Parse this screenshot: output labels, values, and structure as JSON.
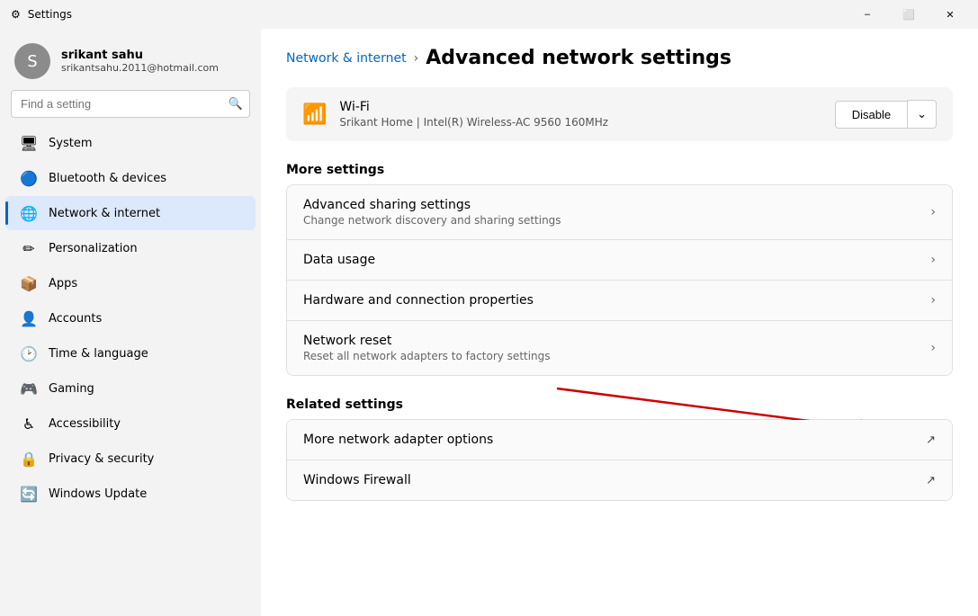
{
  "titlebar": {
    "title": "Settings",
    "minimize": "–",
    "maximize": "⬜",
    "close": "✕"
  },
  "sidebar": {
    "user": {
      "name": "srikant sahu",
      "email": "srikantsahu.2011@hotmail.com",
      "avatar_initial": "S"
    },
    "search_placeholder": "Find a setting",
    "nav_items": [
      {
        "id": "system",
        "label": "System",
        "icon": "🖥",
        "active": false
      },
      {
        "id": "bluetooth",
        "label": "Bluetooth & devices",
        "icon": "🔵",
        "active": false
      },
      {
        "id": "network",
        "label": "Network & internet",
        "icon": "🌐",
        "active": true
      },
      {
        "id": "personalization",
        "label": "Personalization",
        "icon": "✏️",
        "active": false
      },
      {
        "id": "apps",
        "label": "Apps",
        "icon": "📦",
        "active": false
      },
      {
        "id": "accounts",
        "label": "Accounts",
        "icon": "👤",
        "active": false
      },
      {
        "id": "time",
        "label": "Time & language",
        "icon": "🕐",
        "active": false
      },
      {
        "id": "gaming",
        "label": "Gaming",
        "icon": "🎮",
        "active": false
      },
      {
        "id": "accessibility",
        "label": "Accessibility",
        "icon": "♿",
        "active": false
      },
      {
        "id": "privacy",
        "label": "Privacy & security",
        "icon": "🔒",
        "active": false
      },
      {
        "id": "windows-update",
        "label": "Windows Update",
        "icon": "🔄",
        "active": false
      }
    ]
  },
  "content": {
    "breadcrumb_parent": "Network & internet",
    "breadcrumb_sep": "›",
    "page_title": "Advanced network settings",
    "wifi": {
      "name": "Wi-Fi",
      "network": "Srikant Home | Intel(R) Wireless-AC 9560 160MHz",
      "disable_label": "Disable",
      "chevron": "⌄"
    },
    "more_settings_header": "More settings",
    "more_settings": [
      {
        "title": "Advanced sharing settings",
        "subtitle": "Change network discovery and sharing settings"
      },
      {
        "title": "Data usage",
        "subtitle": ""
      },
      {
        "title": "Hardware and connection properties",
        "subtitle": ""
      },
      {
        "title": "Network reset",
        "subtitle": "Reset all network adapters to factory settings"
      }
    ],
    "related_settings_header": "Related settings",
    "related_settings": [
      {
        "title": "More network adapter options",
        "subtitle": "",
        "external": true
      },
      {
        "title": "Windows Firewall",
        "subtitle": "",
        "external": true
      }
    ]
  }
}
